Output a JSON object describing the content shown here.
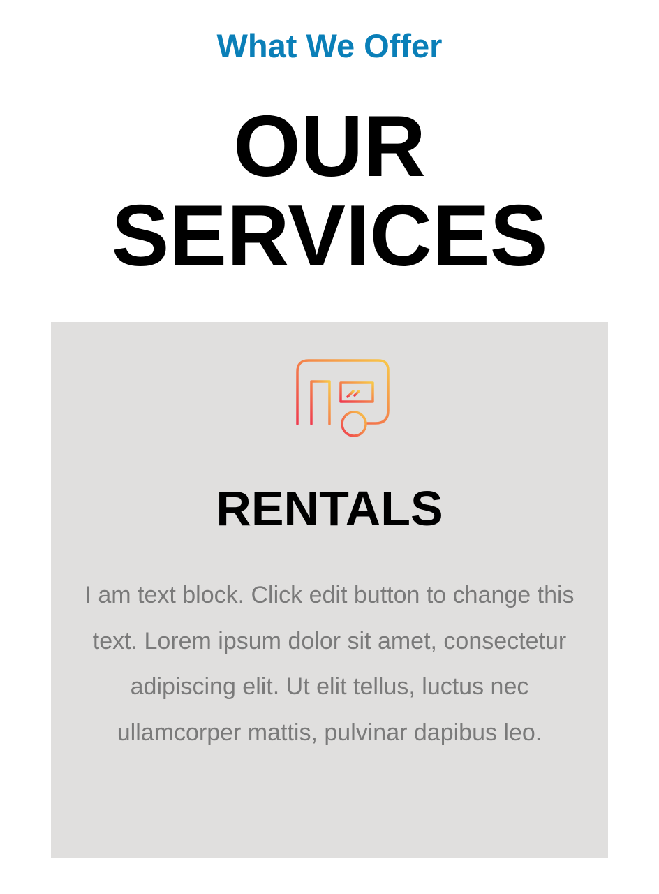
{
  "section": {
    "eyebrow": "What We Offer",
    "title_line1": "OUR",
    "title_line2": "SERVICES"
  },
  "card": {
    "icon": "camper-trailer-icon",
    "title": "RENTALS",
    "text": "I am text block. Click edit button to change this text. Lorem ipsum dolor sit amet, consectetur adipiscing elit. Ut elit tellus, luctus nec ullamcorper mattis, pulvinar dapibus leo."
  },
  "colors": {
    "eyebrow": "#0a7fb8",
    "card_background": "#e0dfde",
    "body_text": "#7a7a7a",
    "icon_gradient_start": "#ef3b4e",
    "icon_gradient_end": "#f8c848"
  }
}
